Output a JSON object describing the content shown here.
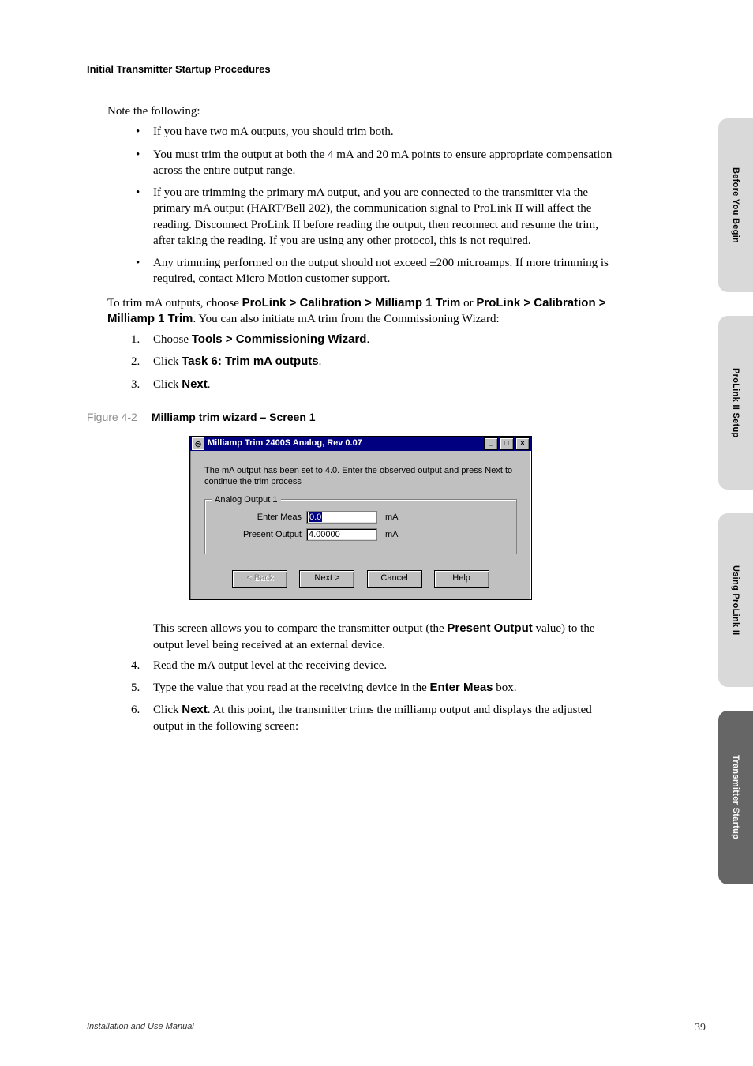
{
  "header": {
    "section_title": "Initial Transmitter Startup Procedures"
  },
  "intro": {
    "note_following": "Note the following:"
  },
  "bullets": [
    "If you have two mA outputs, you should trim both.",
    "You must trim the output at both the 4 mA and 20 mA points to ensure appropriate compensation across the entire output range.",
    "If you are trimming the primary mA output, and you are connected to the transmitter via the primary mA output (HART/Bell 202), the communication signal to ProLink II will affect the reading. Disconnect ProLink II before reading the output, then reconnect and resume the trim, after taking the reading. If you are using any other protocol, this is not required.",
    "Any trimming performed on the output should not exceed ±200 microamps. If more trimming is required, contact Micro Motion customer support."
  ],
  "trim_sentence": {
    "pre": "To trim mA outputs, choose ",
    "path1": "ProLink > Calibration > Milliamp 1 Trim",
    "mid": " or ",
    "path2": "ProLink > Calibration > Milliamp 1 Trim",
    "post": ". You can also initiate mA trim from the Commissioning Wizard:"
  },
  "steps_a": {
    "s1_pre": "Choose ",
    "s1_bold": "Tools > Commissioning Wizard",
    "s1_post": ".",
    "s2_pre": "Click ",
    "s2_bold": "Task 6: Trim mA outputs",
    "s2_post": ".",
    "s3_pre": "Click ",
    "s3_bold": "Next",
    "s3_post": "."
  },
  "figure": {
    "num": "Figure 4-2",
    "title": "Milliamp trim wizard – Screen 1"
  },
  "dialog": {
    "title": "Milliamp Trim 2400S Analog, Rev 0.07",
    "instruction": "The mA output has been set to 4.0.  Enter the observed output and press Next to continue the trim process",
    "group_legend": "Analog Output 1",
    "row1_label": "Enter Meas",
    "row1_value": "0.0",
    "row1_unit": "mA",
    "row2_label": "Present Output",
    "row2_value": "4.00000",
    "row2_unit": "mA",
    "btn_back": "< Back",
    "btn_next": "Next >",
    "btn_cancel": "Cancel",
    "btn_help": "Help",
    "winbtn_min": "_",
    "winbtn_max": "□",
    "winbtn_close": "×"
  },
  "after_fig": {
    "p_pre": "This screen allows you to compare the transmitter output (the ",
    "p_bold": "Present Output",
    "p_post": " value) to the output level being received at an external device."
  },
  "steps_b": {
    "s4": "Read the mA output level at the receiving device.",
    "s5_pre": "Type the value that you read at the receiving device in the ",
    "s5_bold": "Enter Meas",
    "s5_post": " box.",
    "s6_pre": "Click ",
    "s6_bold": "Next",
    "s6_post": ". At this point, the transmitter trims the milliamp output and displays the adjusted output in the following screen:"
  },
  "tabs": {
    "t1": "Before You Begin",
    "t2": "ProLink II Setup",
    "t3": "Using ProLink II",
    "t4": "Transmitter Startup"
  },
  "footer": {
    "left": "Installation and Use Manual",
    "page": "39"
  }
}
